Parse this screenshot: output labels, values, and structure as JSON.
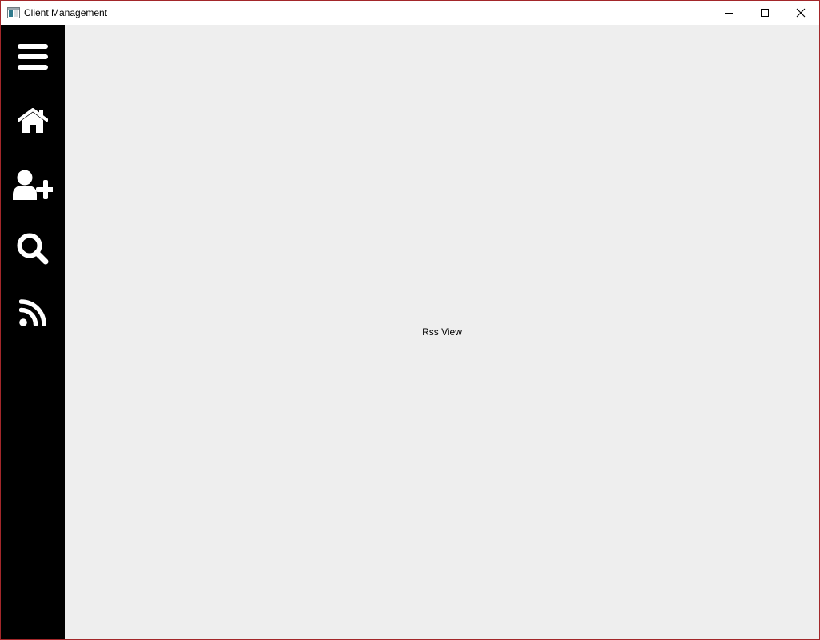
{
  "window": {
    "title": "Client Management",
    "controls": {
      "minimize_icon": "minimize-icon",
      "maximize_icon": "maximize-icon",
      "close_icon": "close-icon"
    },
    "border_color": "#a3272a"
  },
  "sidebar": {
    "background": "#000000",
    "icon_color": "#ffffff",
    "items": [
      {
        "icon": "hamburger-menu-icon"
      },
      {
        "icon": "home-icon"
      },
      {
        "icon": "add-user-icon"
      },
      {
        "icon": "search-icon"
      },
      {
        "icon": "rss-icon"
      }
    ]
  },
  "content": {
    "background": "#eeeeee",
    "label": "Rss View"
  }
}
